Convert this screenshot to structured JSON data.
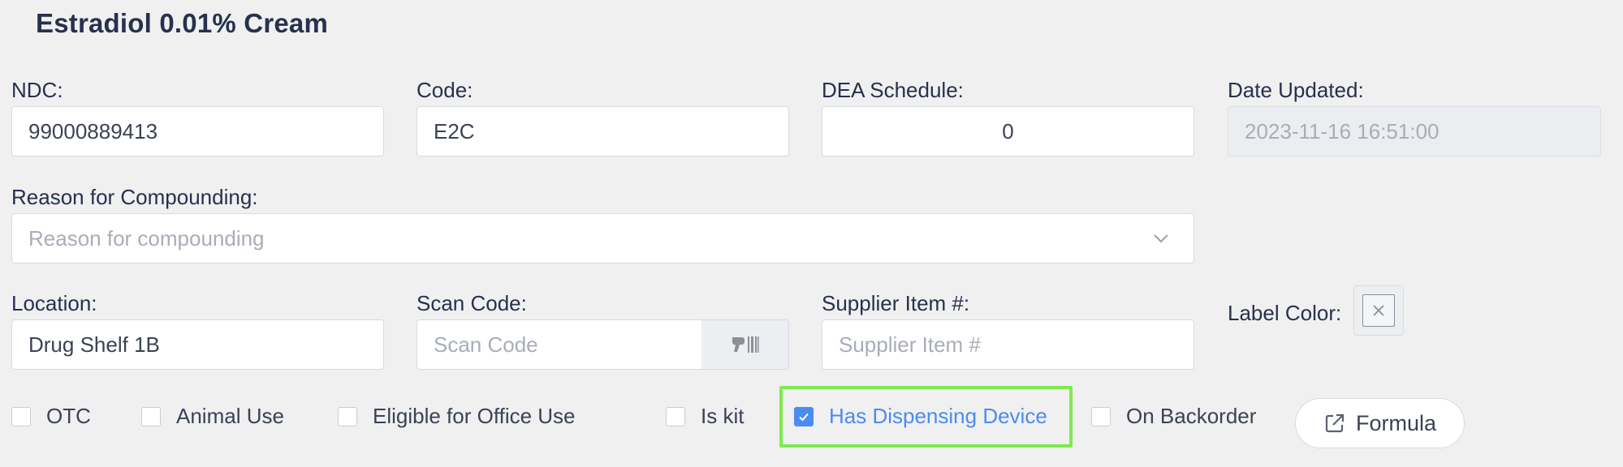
{
  "header": {
    "title": "Estradiol 0.01% Cream"
  },
  "fields": {
    "ndc": {
      "label": "NDC:",
      "value": "99000889413"
    },
    "code": {
      "label": "Code:",
      "value": "E2C"
    },
    "dea_schedule": {
      "label": "DEA Schedule:",
      "value": "0"
    },
    "date_updated": {
      "label": "Date Updated:",
      "value": "2023-11-16 16:51:00"
    },
    "reason": {
      "label": "Reason for Compounding:",
      "placeholder": "Reason for compounding"
    },
    "location": {
      "label": "Location:",
      "value": "Drug Shelf 1B"
    },
    "scan_code": {
      "label": "Scan Code:",
      "placeholder": "Scan Code",
      "addon_icon": "barcode-scanner-icon"
    },
    "supplier_item": {
      "label": "Supplier Item #:",
      "placeholder": "Supplier Item #"
    },
    "label_color": {
      "label": "Label Color:",
      "icon": "close-icon",
      "value": "none"
    }
  },
  "checkboxes": [
    {
      "label": "OTC",
      "checked": false
    },
    {
      "label": "Animal Use",
      "checked": false
    },
    {
      "label": "Eligible for Office Use",
      "checked": false
    },
    {
      "label": "Is kit",
      "checked": false
    },
    {
      "label": "Has Dispensing Device",
      "checked": true
    },
    {
      "label": "On Backorder",
      "checked": false
    }
  ],
  "actions": {
    "formula_label": "Formula",
    "formula_icon": "external-link-icon"
  },
  "colors": {
    "accent": "#4a8cf0",
    "highlight": "#7fea4e",
    "text": "#26314d",
    "background": "#f0f0f1"
  }
}
